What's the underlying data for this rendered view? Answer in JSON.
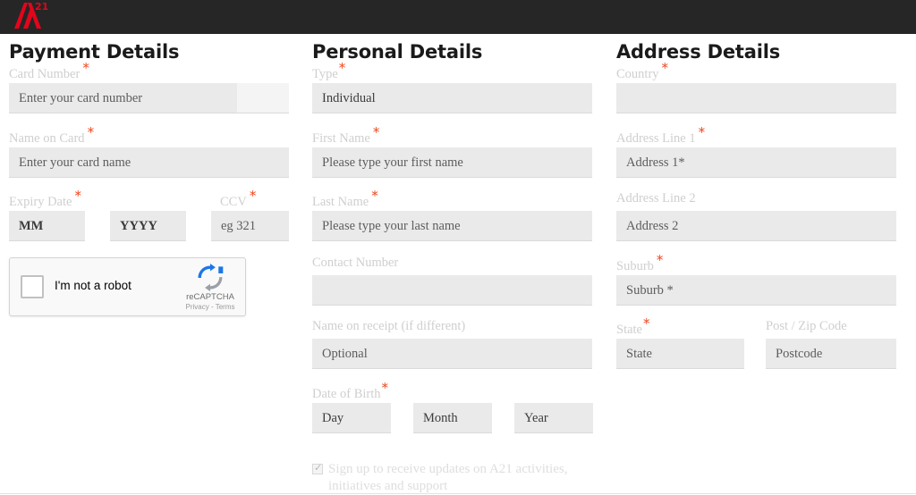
{
  "header": {
    "logo_name": "a21-logo",
    "logo_text": "21",
    "background_color": "#262626",
    "logo_color": "#e3051b"
  },
  "theme": {
    "required_marker_color": "#f1441a",
    "input_background": "#eaeaea",
    "label_color": "#cfcfcf",
    "heading_color": "#1a1a1a"
  },
  "payment": {
    "title": "Payment Details",
    "card_number": {
      "label": "Card Number",
      "required": true,
      "placeholder": "Enter your card number",
      "value": ""
    },
    "name_on_card": {
      "label": "Name on Card",
      "required": true,
      "placeholder": "Enter your card name",
      "value": ""
    },
    "expiry": {
      "label": "Expiry Date",
      "required": true,
      "month_placeholder": "MM",
      "year_placeholder": "YYYY",
      "month_value": "MM",
      "year_value": "YYYY"
    },
    "ccv": {
      "label": "CCV",
      "required": true,
      "placeholder": "eg 321",
      "value": ""
    },
    "recaptcha": {
      "checkbox_label": "I'm not a robot",
      "brand": "reCAPTCHA",
      "legal": "Privacy - Terms",
      "checked": false
    }
  },
  "personal": {
    "title": "Personal Details",
    "type": {
      "label": "Type",
      "required": true,
      "value": "Individual",
      "options": [
        "Individual"
      ]
    },
    "first_name": {
      "label": "First Name",
      "required": true,
      "placeholder": "Please type your first name",
      "value": ""
    },
    "last_name": {
      "label": "Last Name",
      "required": true,
      "placeholder": "Please type your last name",
      "value": ""
    },
    "contact_number": {
      "label": "Contact Number",
      "required": false,
      "placeholder": "",
      "value": ""
    },
    "name_on_receipt": {
      "label": "Name on receipt (if different)",
      "required": false,
      "placeholder": "Optional",
      "value": ""
    },
    "date_of_birth": {
      "label": "Date of Birth",
      "required": true,
      "day_placeholder": "Day",
      "month_placeholder": "Month",
      "year_placeholder": "Year",
      "day_value": "Day",
      "month_value": "Month",
      "year_value": "Year"
    },
    "signup": {
      "label": "Sign up to receive updates on A21 activities, initiatives and support",
      "checked": true,
      "tick_glyph": "✓"
    }
  },
  "address": {
    "title": "Address Details",
    "country": {
      "label": "Country",
      "required": true,
      "placeholder": "",
      "value": ""
    },
    "address_line_1": {
      "label": "Address Line 1",
      "required": true,
      "placeholder": "Address 1*",
      "value": ""
    },
    "address_line_2": {
      "label": "Address Line 2",
      "required": false,
      "placeholder": "Address 2",
      "value": ""
    },
    "suburb": {
      "label": "Suburb",
      "required": true,
      "placeholder": "Suburb *",
      "value": ""
    },
    "state": {
      "label": "State",
      "required": true,
      "placeholder": "State",
      "value": ""
    },
    "postcode": {
      "label": "Post / Zip Code",
      "required": false,
      "placeholder": "Postcode",
      "value": ""
    }
  }
}
